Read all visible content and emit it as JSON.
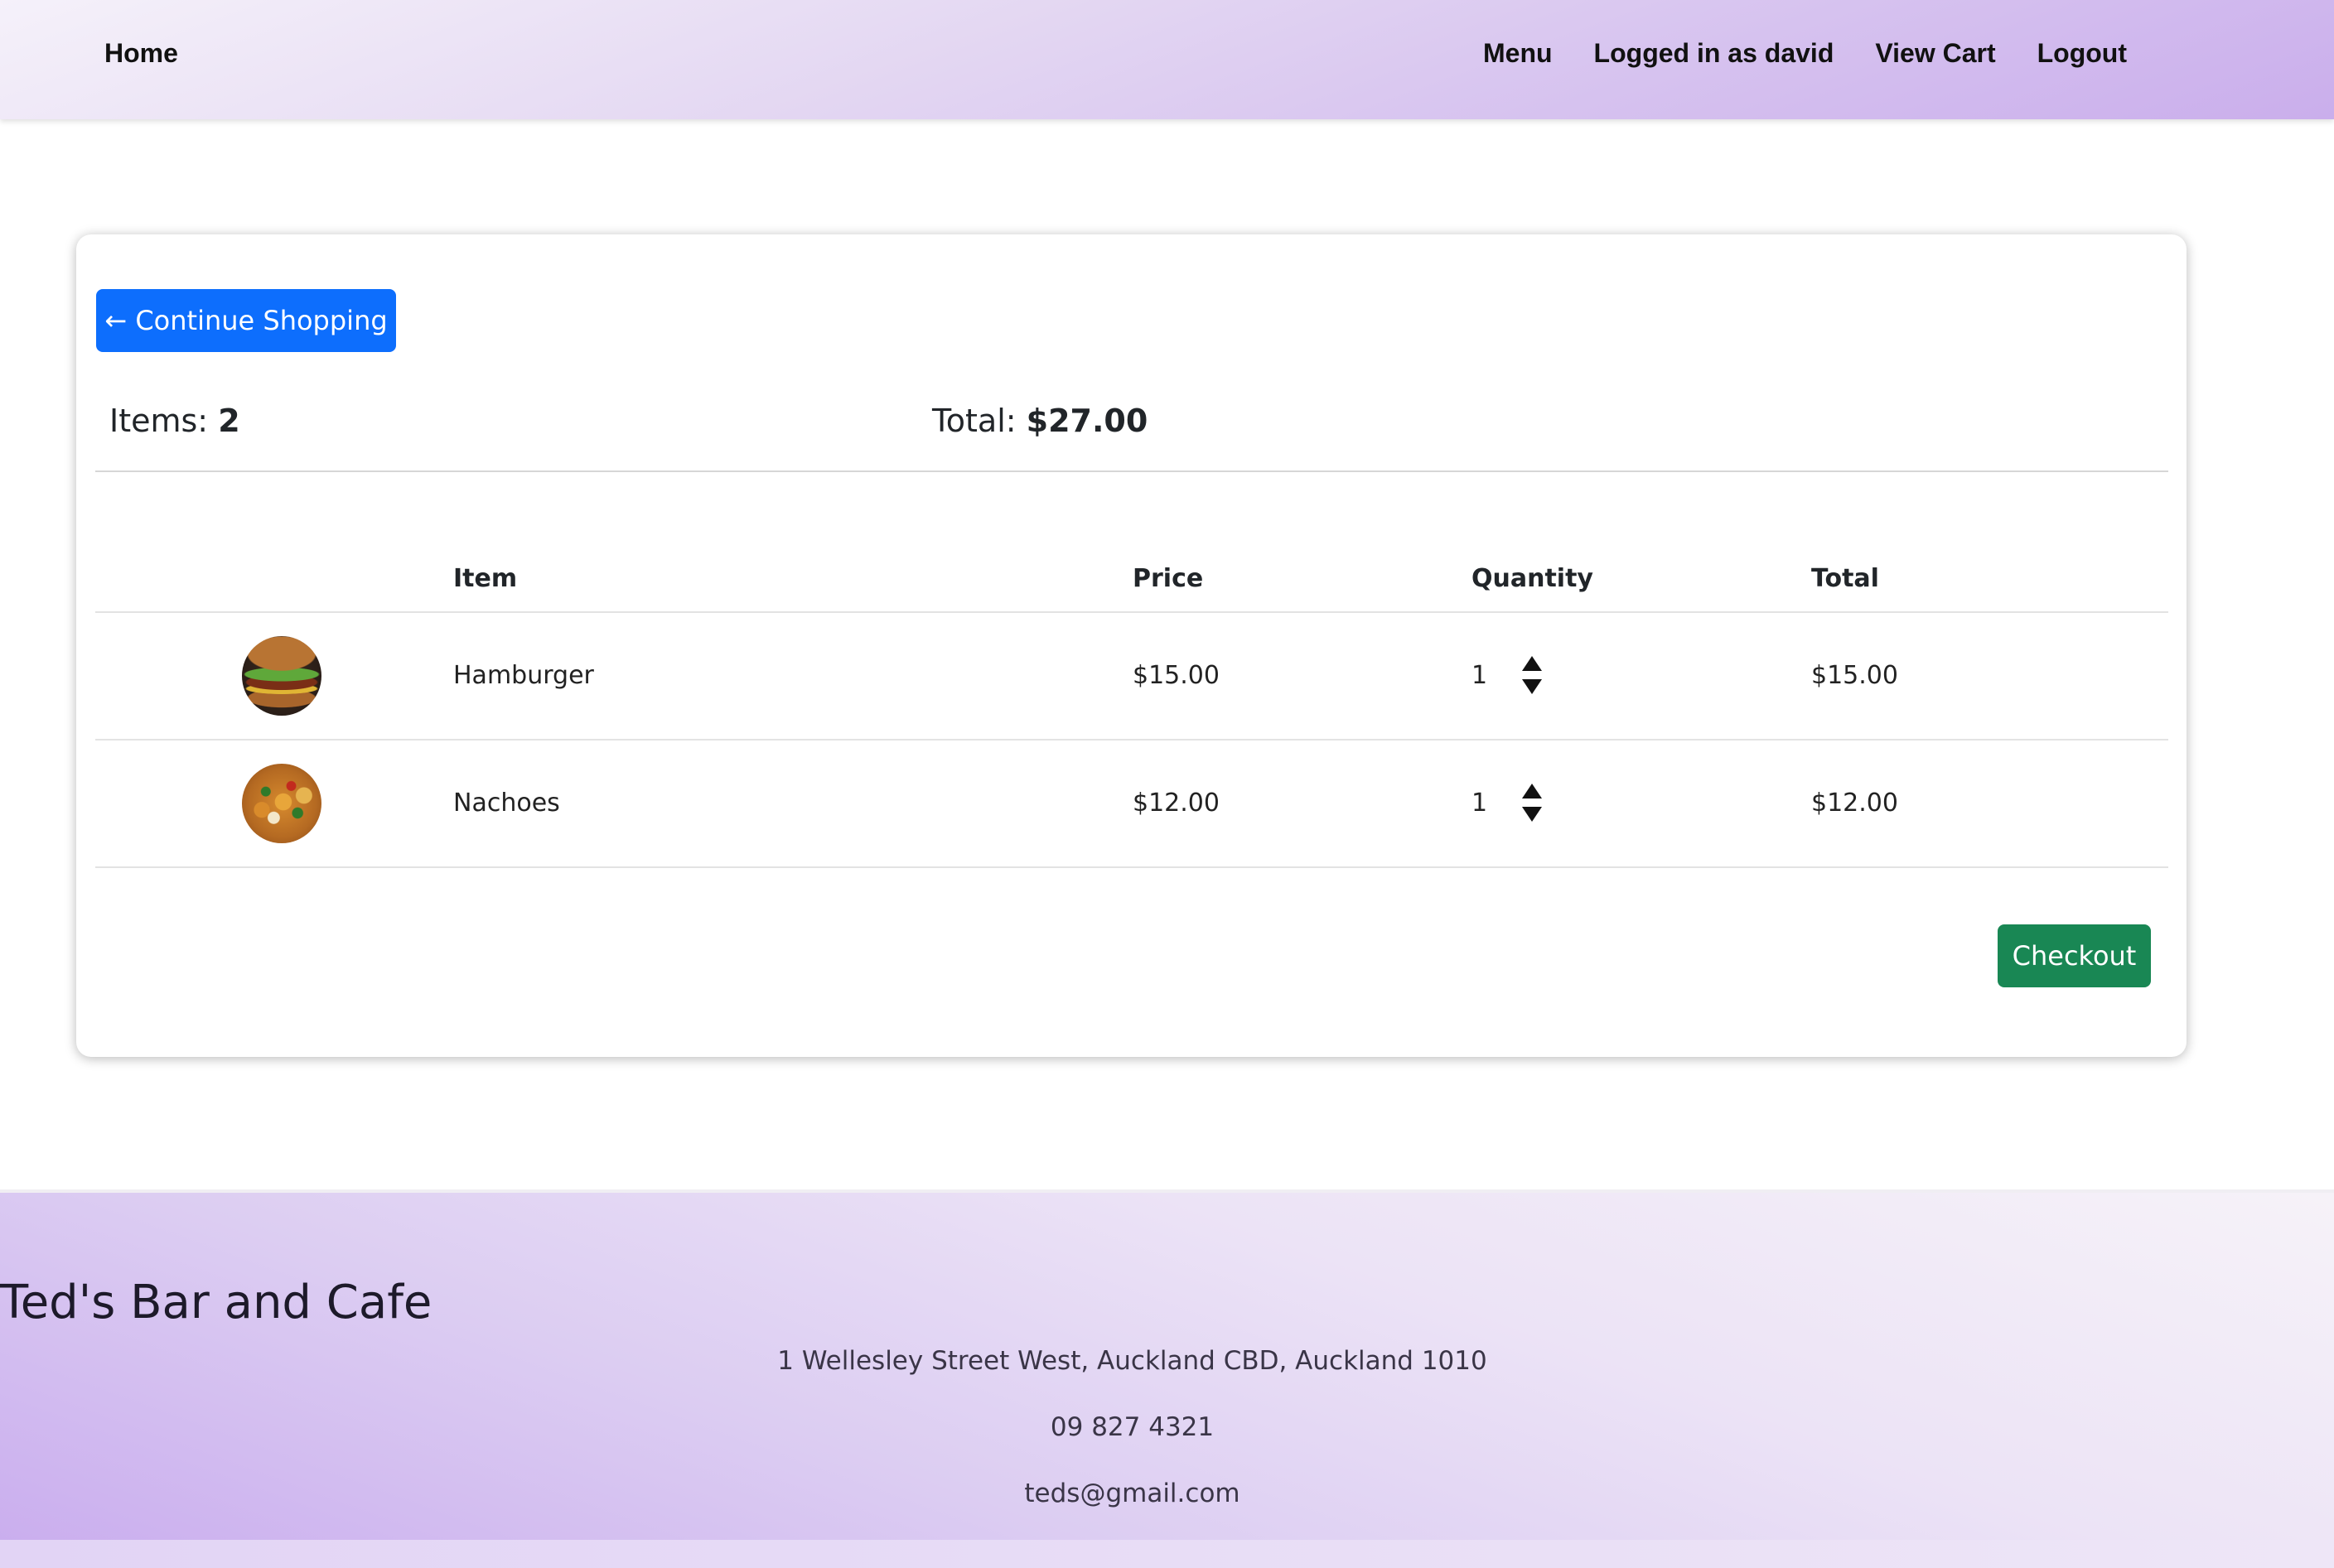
{
  "nav": {
    "home": "Home",
    "menu": "Menu",
    "user": "Logged in as david",
    "cart": "View Cart",
    "logout": "Logout"
  },
  "cart": {
    "continue_label": "← Continue Shopping",
    "items_label": "Items: ",
    "items_count": "2",
    "total_label": "Total: ",
    "total_value": "$27.00",
    "columns": [
      "Item",
      "Price",
      "Quantity",
      "Total"
    ],
    "rows": [
      {
        "name": "Hamburger",
        "price": "$15.00",
        "quantity": "1",
        "total": "$15.00",
        "image": "hamburger-photo"
      },
      {
        "name": "Nachoes",
        "price": "$12.00",
        "quantity": "1",
        "total": "$12.00",
        "image": "nachos-photo"
      }
    ],
    "checkout_label": "Checkout"
  },
  "footer": {
    "title": "Ted's Bar and Cafe",
    "address": "1 Wellesley Street West, Auckland CBD, Auckland 1010",
    "phone": "09 827 4321",
    "email": "teds@gmail.com"
  },
  "colors": {
    "primary": "#0d6efd",
    "success": "#198754",
    "nav_gradient_end": "#caaeec"
  }
}
